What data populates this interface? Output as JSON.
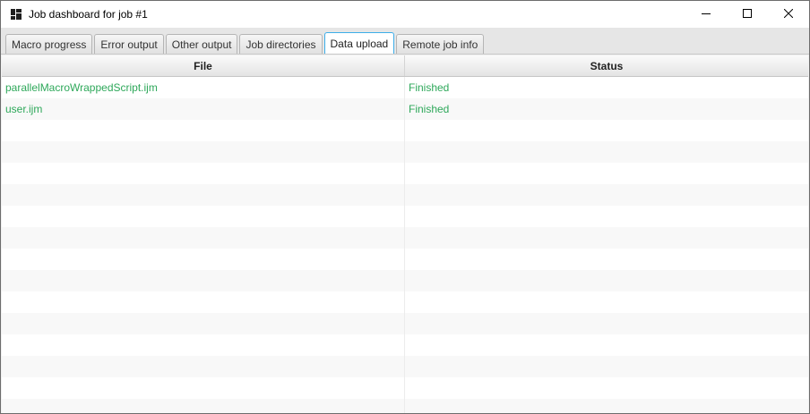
{
  "window": {
    "title": "Job dashboard for job #1",
    "icon": "dashboard-icon",
    "controls": [
      "minimize-icon",
      "maximize-icon",
      "close-icon"
    ]
  },
  "tabs": [
    {
      "label": "Macro progress",
      "selected": false
    },
    {
      "label": "Error output",
      "selected": false
    },
    {
      "label": "Other output",
      "selected": false
    },
    {
      "label": "Job directories",
      "selected": false
    },
    {
      "label": "Data upload",
      "selected": true
    },
    {
      "label": "Remote job info",
      "selected": false
    }
  ],
  "table": {
    "columns": [
      "File",
      "Status"
    ],
    "rows": [
      {
        "file": "parallelMacroWrappedScript.ijm",
        "status": "Finished"
      },
      {
        "file": "user.ijm",
        "status": "Finished"
      }
    ]
  },
  "colors": {
    "status_text": "#2ea85a",
    "selected_tab_border": "#3daee9"
  }
}
